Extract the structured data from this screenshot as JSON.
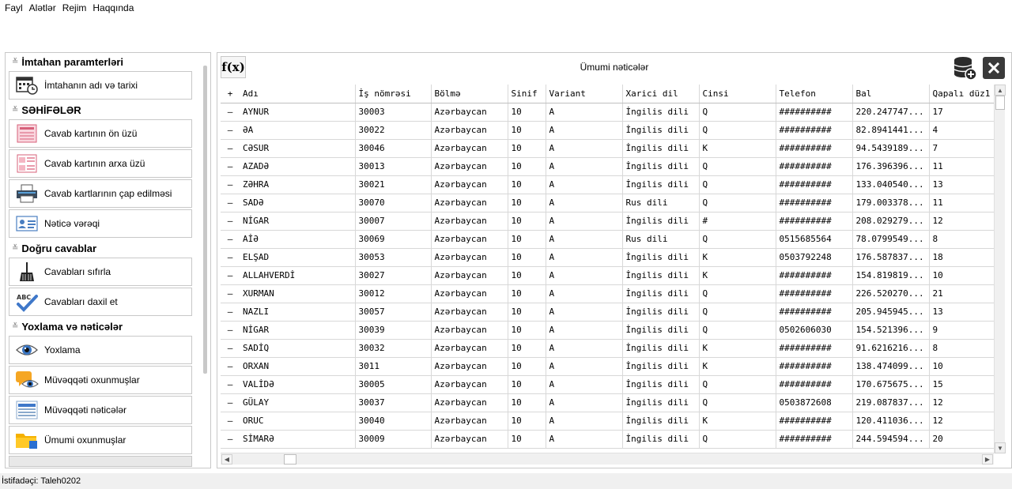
{
  "menu": [
    "Fayl",
    "Alətlər",
    "Rejim",
    "Haqqında"
  ],
  "sidebar": {
    "sections": [
      {
        "title": "İmtahan paramterləri",
        "items": [
          {
            "label": "İmtahanın adı və tarixi",
            "icon": "calendar-clock-icon"
          }
        ]
      },
      {
        "title": "SƏHİFƏLƏR",
        "items": [
          {
            "label": "Cavab kartının ön üzü",
            "icon": "form-front-icon"
          },
          {
            "label": "Cavab kartının arxa üzü",
            "icon": "form-back-icon"
          },
          {
            "label": "Cavab kartlarının çap edilməsi",
            "icon": "printer-icon"
          },
          {
            "label": "Nəticə vərəqi",
            "icon": "id-card-icon"
          }
        ]
      },
      {
        "title": "Doğru cavablar",
        "items": [
          {
            "label": "Cavabları sıfırla",
            "icon": "broom-icon"
          },
          {
            "label": "Cavabları daxil et",
            "icon": "abc-check-icon"
          }
        ]
      },
      {
        "title": "Yoxlama və nəticələr",
        "items": [
          {
            "label": "Yoxlama",
            "icon": "eye-icon"
          },
          {
            "label": "Müvəqqəti oxunmuşlar",
            "icon": "eye-chat-icon"
          },
          {
            "label": "Müvəqqəti nəticələr",
            "icon": "list-icon"
          },
          {
            "label": "Ümumi oxunmuşlar",
            "icon": "folder-icon"
          }
        ]
      }
    ]
  },
  "panel": {
    "title": "Ümumi nəticələr",
    "fx_label": "f(x)"
  },
  "table": {
    "expand_all": "+",
    "columns": [
      "Adı",
      "İş nömrəsi",
      "Bölmə",
      "Sinif",
      "Variant",
      "Xarici dil",
      "Cinsi",
      "Telefon",
      "Bal",
      "Qapalı düz1"
    ],
    "rows": [
      [
        "AYNUR",
        "30003",
        "Azərbaycan",
        "10",
        "A",
        "İngilis dili",
        "Q",
        "##########",
        "220.247747...",
        "17"
      ],
      [
        "ƏA",
        "30022",
        "Azərbaycan",
        "10",
        "A",
        "İngilis dili",
        "Q",
        "##########",
        "82.8941441...",
        "4"
      ],
      [
        "CƏSUR",
        "30046",
        "Azərbaycan",
        "10",
        "A",
        "İngilis dili",
        "K",
        "##########",
        "94.5439189...",
        "7"
      ],
      [
        "AZADƏ",
        "30013",
        "Azərbaycan",
        "10",
        "A",
        "İngilis dili",
        "Q",
        "##########",
        "176.396396...",
        "11"
      ],
      [
        "ZƏHRA",
        "30021",
        "Azərbaycan",
        "10",
        "A",
        "İngilis dili",
        "Q",
        "##########",
        "133.040540...",
        "13"
      ],
      [
        "SADƏ",
        "30070",
        "Azərbaycan",
        "10",
        "A",
        "Rus dili",
        "Q",
        "##########",
        "179.003378...",
        "11"
      ],
      [
        "NİGAR",
        "30007",
        "Azərbaycan",
        "10",
        "A",
        "İngilis dili",
        "#",
        "##########",
        "208.029279...",
        "12"
      ],
      [
        "AİƏ",
        "30069",
        "Azərbaycan",
        "10",
        "A",
        "Rus dili",
        "Q",
        "0515685564",
        "78.0799549...",
        "8"
      ],
      [
        "ELŞAD",
        "30053",
        "Azərbaycan",
        "10",
        "A",
        "İngilis dili",
        "K",
        "0503792248",
        "176.587837...",
        "18"
      ],
      [
        "ALLAHVERDİ",
        "30027",
        "Azərbaycan",
        "10",
        "A",
        "İngilis dili",
        "K",
        "##########",
        "154.819819...",
        "10"
      ],
      [
        "XURMAN",
        "30012",
        "Azərbaycan",
        "10",
        "A",
        "İngilis dili",
        "Q",
        "##########",
        "226.520270...",
        "21"
      ],
      [
        "NAZLI",
        "30057",
        "Azərbaycan",
        "10",
        "A",
        "İngilis dili",
        "Q",
        "##########",
        "205.945945...",
        "13"
      ],
      [
        "NİGAR",
        "30039",
        "Azərbaycan",
        "10",
        "A",
        "İngilis dili",
        "Q",
        "0502606030",
        "154.521396...",
        "9"
      ],
      [
        "SADİQ",
        "30032",
        "Azərbaycan",
        "10",
        "A",
        "İngilis dili",
        "K",
        "##########",
        "91.6216216...",
        "8"
      ],
      [
        "ORXAN",
        "3011",
        "Azərbaycan",
        "10",
        "A",
        "İngilis dili",
        "K",
        "##########",
        "138.474099...",
        "10"
      ],
      [
        "VALİDƏ",
        "30005",
        "Azərbaycan",
        "10",
        "A",
        "İngilis dili",
        "Q",
        "##########",
        "170.675675...",
        "15"
      ],
      [
        "GÜLAY",
        "30037",
        "Azərbaycan",
        "10",
        "A",
        "İngilis dili",
        "Q",
        "0503872608",
        "219.087837...",
        "12"
      ],
      [
        "ORUC",
        "30040",
        "Azərbaycan",
        "10",
        "A",
        "İngilis dili",
        "K",
        "##########",
        "120.411036...",
        "12"
      ],
      [
        "SİMARƏ",
        "30009",
        "Azərbaycan",
        "10",
        "A",
        "İngilis dili",
        "Q",
        "##########",
        "244.594594...",
        "20"
      ]
    ]
  },
  "status": {
    "text": "İstifadəçi: Taleh0202"
  }
}
